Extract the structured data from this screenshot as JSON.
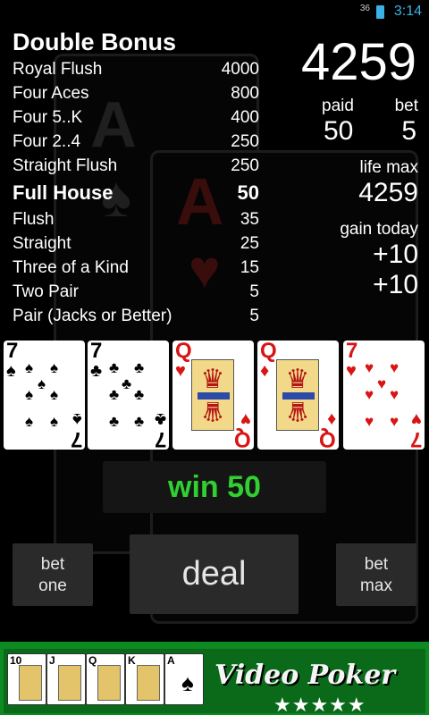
{
  "status": {
    "signal": "36",
    "time": "3:14"
  },
  "paytable": {
    "title": "Double Bonus",
    "rows": [
      {
        "name": "Royal Flush",
        "value": "4000"
      },
      {
        "name": "Four Aces",
        "value": "800"
      },
      {
        "name": "Four 5..K",
        "value": "400"
      },
      {
        "name": "Four 2..4",
        "value": "250"
      },
      {
        "name": "Straight Flush",
        "value": "250"
      },
      {
        "name": "Full House",
        "value": "50"
      },
      {
        "name": "Flush",
        "value": "35"
      },
      {
        "name": "Straight",
        "value": "25"
      },
      {
        "name": "Three of a Kind",
        "value": "15"
      },
      {
        "name": "Two Pair",
        "value": "5"
      },
      {
        "name": "Pair (Jacks or Better)",
        "value": "5"
      }
    ],
    "highlighted": "Full House"
  },
  "stats": {
    "credits": "4259",
    "paid_label": "paid",
    "paid": "50",
    "bet_label": "bet",
    "bet": "5",
    "life_max_label": "life max",
    "life_max": "4259",
    "gain_today_label": "gain today",
    "gain_1": "+10",
    "gain_2": "+10"
  },
  "hand": [
    {
      "rank": "7",
      "suit": "♠",
      "color": "black"
    },
    {
      "rank": "7",
      "suit": "♣",
      "color": "black"
    },
    {
      "rank": "Q",
      "suit": "♥",
      "color": "red"
    },
    {
      "rank": "Q",
      "suit": "♦",
      "color": "red"
    },
    {
      "rank": "7",
      "suit": "♥",
      "color": "red"
    }
  ],
  "result": {
    "text": "win 50",
    "color": "#30d030"
  },
  "buttons": {
    "bet_one_line1": "bet",
    "bet_one_line2": "one",
    "deal": "deal",
    "bet_max_line1": "bet",
    "bet_max_line2": "max"
  },
  "banner": {
    "cards": [
      "10",
      "J",
      "Q",
      "K",
      "A"
    ],
    "brand": "Video Poker",
    "stars": "★★★★★"
  }
}
